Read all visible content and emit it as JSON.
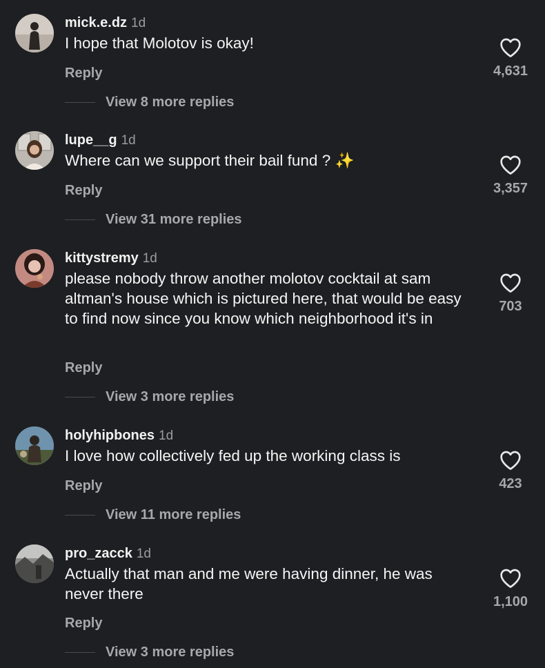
{
  "comments": [
    {
      "username": "mick.e.dz",
      "time": "1d",
      "text": "I hope that Molotov is okay!",
      "reply_label": "Reply",
      "view_more": "View 8 more replies",
      "likes": "4,631",
      "avatar_icon": "avatar-person-standing",
      "avatar_colors": [
        "#c9c3bb",
        "#2a2624"
      ]
    },
    {
      "username": "lupe__g",
      "time": "1d",
      "text": "Where can we support their bail fund ? ✨",
      "reply_label": "Reply",
      "view_more": "View 31 more replies",
      "likes": "3,357",
      "avatar_icon": "avatar-person-window",
      "avatar_colors": [
        "#b9b4ae",
        "#5b3e2c"
      ]
    },
    {
      "username": "kittystremy",
      "time": "1d",
      "text": "please nobody throw another molotov cocktail at sam altman's house which is pictured here, that would be easy to find now since you know which neighborhood it's in",
      "reply_label": "Reply",
      "view_more": "View 3 more replies",
      "likes": "703",
      "avatar_icon": "avatar-person-red",
      "avatar_colors": [
        "#c9847e",
        "#2a1a16"
      ]
    },
    {
      "username": "holyhipbones",
      "time": "1d",
      "text": "I love how collectively fed up the working class is",
      "reply_label": "Reply",
      "view_more": "View 11 more replies",
      "likes": "423",
      "avatar_icon": "avatar-person-outdoor",
      "avatar_colors": [
        "#6d8fa8",
        "#3b3a30"
      ]
    },
    {
      "username": "pro_zacck",
      "time": "1d",
      "text": "Actually that man and me were having dinner, he was never there",
      "reply_label": "Reply",
      "view_more": "View 3 more replies",
      "likes": "1,100",
      "avatar_icon": "avatar-grayscale-photo",
      "avatar_colors": [
        "#9a9a98",
        "#2c2c2b"
      ]
    }
  ]
}
